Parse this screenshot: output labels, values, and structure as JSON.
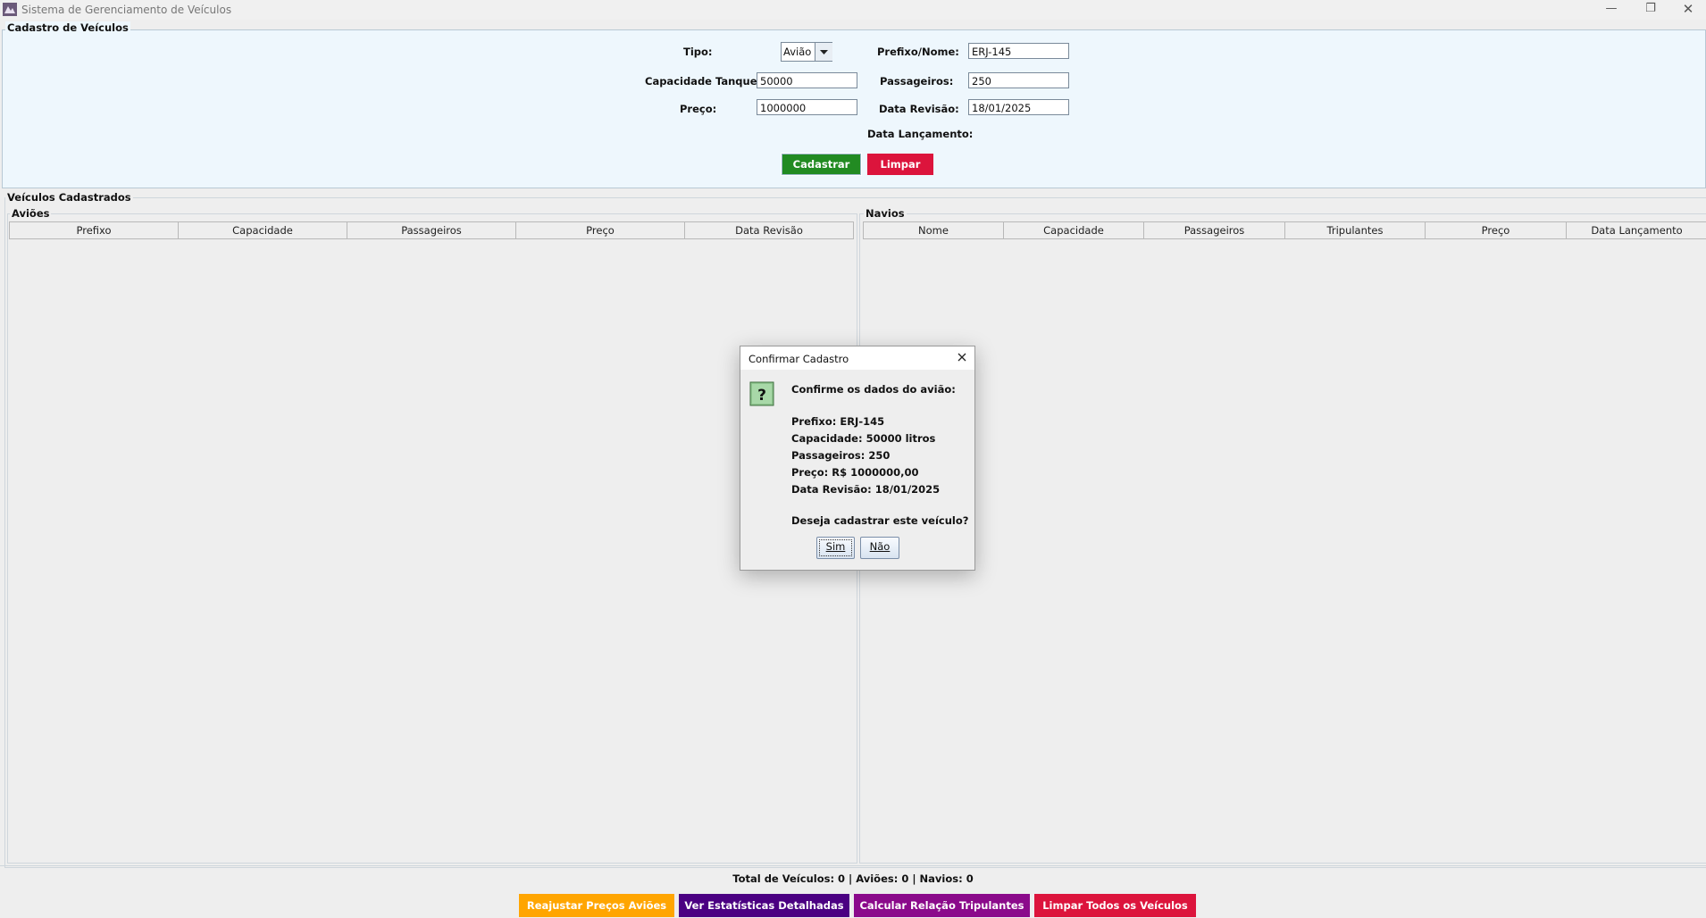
{
  "window": {
    "title": "Sistema de Gerenciamento de Veículos",
    "controls": [
      "—",
      "❐",
      "✕"
    ]
  },
  "form": {
    "group_title": "Cadastro de Veículos",
    "tipo_label": "Tipo:",
    "tipo_value": "Avião",
    "prefixo_label": "Prefixo/Nome:",
    "prefixo_value": "ERJ-145",
    "capacidade_label": "Capacidade Tanque:",
    "capacidade_value": "50000",
    "passageiros_label": "Passageiros:",
    "passageiros_value": "250",
    "preco_label": "Preço:",
    "preco_value": "1000000",
    "data_revisao_label": "Data Revisão:",
    "data_revisao_value": "18/01/2025",
    "data_lancamento_label": "Data Lançamento:",
    "cadastrar_label": "Cadastrar",
    "limpar_label": "Limpar"
  },
  "list": {
    "group_title": "Veículos Cadastrados",
    "avioes": {
      "title": "Aviões",
      "columns": [
        "Prefixo",
        "Capacidade",
        "Passageiros",
        "Preço",
        "Data Revisão"
      ]
    },
    "navios": {
      "title": "Navios",
      "columns": [
        "Nome",
        "Capacidade",
        "Passageiros",
        "Tripulantes",
        "Preço",
        "Data Lançamento"
      ]
    }
  },
  "footer": {
    "status": "Total de Veículos: 0 | Aviões: 0 | Navios: 0",
    "buttons": [
      {
        "label": "Reajustar Preços Aviões",
        "color": "#ffa500",
        "text_color": "#ffffff"
      },
      {
        "label": "Ver Estatísticas Detalhadas",
        "color": "#4b0082",
        "text_color": "#ffffff"
      },
      {
        "label": "Calcular Relação Tripulantes",
        "color": "#8b0a8b",
        "text_color": "#ffffff"
      },
      {
        "label": "Limpar Todos os Veículos",
        "color": "#dc143c",
        "text_color": "#ffffff"
      }
    ]
  },
  "dialog": {
    "title": "Confirmar Cadastro",
    "icon": "question-icon",
    "heading": "Confirme os dados do avião:",
    "lines": [
      "Prefixo:  ERJ-145",
      "Capacidade: 50000 litros",
      "Passageiros: 250",
      "Preço: R$ 1000000,00",
      "Data Revisão: 18/01/2025"
    ],
    "question": "Deseja cadastrar este veículo?",
    "yes_label": "Sim",
    "no_label": "Não"
  },
  "colors": {
    "cadastrar": "#228b22",
    "limpar": "#dc143c",
    "form_bg": "#eef7fd"
  }
}
